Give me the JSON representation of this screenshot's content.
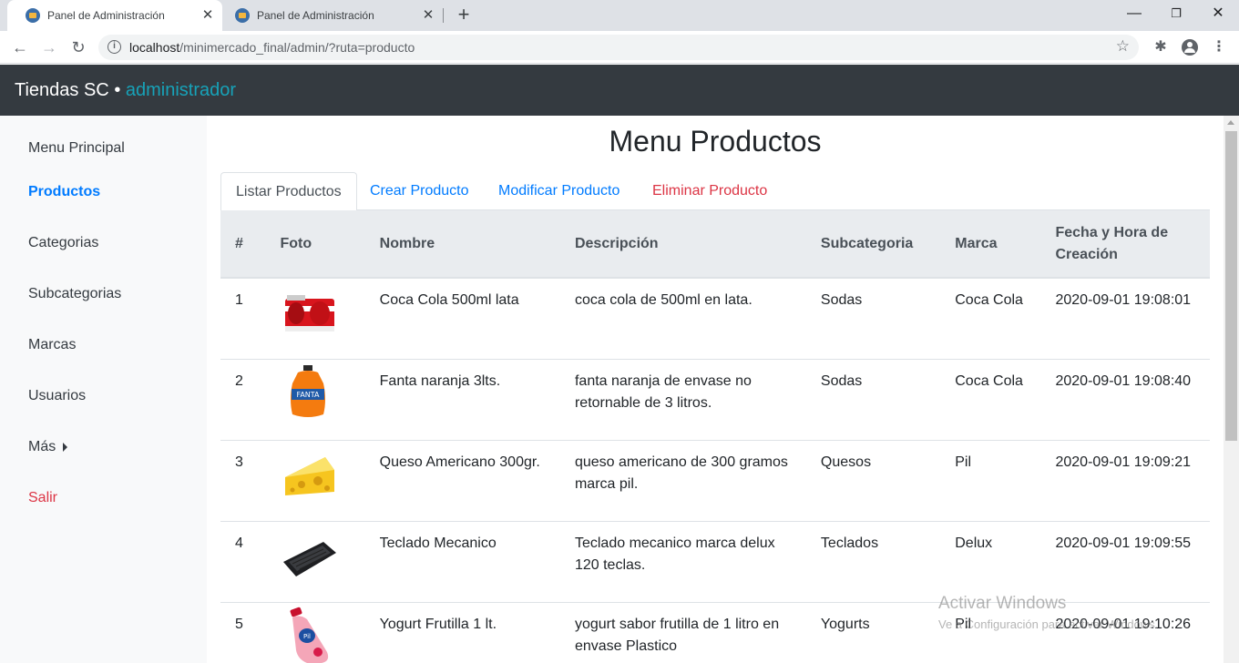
{
  "browser": {
    "tabs": [
      {
        "title": "Panel de Administración"
      },
      {
        "title": "Panel de Administración"
      }
    ],
    "url_host": "localhost",
    "url_path": "/minimercado_final/admin/?ruta=producto"
  },
  "app": {
    "brand": "Tiendas SC",
    "separator": "•",
    "role": "administrador"
  },
  "sidebar": {
    "items": [
      {
        "label": "Menu Principal"
      },
      {
        "label": "Productos"
      },
      {
        "label": "Categorias"
      },
      {
        "label": "Subcategorias"
      },
      {
        "label": "Marcas"
      },
      {
        "label": "Usuarios"
      },
      {
        "label": "Más"
      },
      {
        "label": "Salir"
      }
    ]
  },
  "main": {
    "title": "Menu Productos",
    "tabs": [
      {
        "label": "Listar Productos"
      },
      {
        "label": "Crear Producto"
      },
      {
        "label": "Modificar Producto"
      },
      {
        "label": "Eliminar Producto"
      }
    ]
  },
  "table": {
    "headers": [
      "#",
      "Foto",
      "Nombre",
      "Descripción",
      "Subcategoria",
      "Marca",
      "Fecha y Hora de Creación"
    ],
    "rows": [
      {
        "num": "1",
        "photo": "coca-cola-can-pack",
        "nombre": "Coca Cola 500ml lata",
        "descripcion": "coca cola de 500ml en lata.",
        "subcategoria": "Sodas",
        "marca": "Coca Cola",
        "fecha": "2020-09-01 19:08:01"
      },
      {
        "num": "2",
        "photo": "fanta-bottle",
        "nombre": "Fanta naranja 3lts.",
        "descripcion": "fanta naranja de envase no retornable de 3 litros.",
        "subcategoria": "Sodas",
        "marca": "Coca Cola",
        "fecha": "2020-09-01 19:08:40"
      },
      {
        "num": "3",
        "photo": "cheese-wedge",
        "nombre": "Queso Americano 300gr.",
        "descripcion": "queso americano de 300 gramos marca pil.",
        "subcategoria": "Quesos",
        "marca": "Pil",
        "fecha": "2020-09-01 19:09:21"
      },
      {
        "num": "4",
        "photo": "keyboard",
        "nombre": "Teclado Mecanico",
        "descripcion": "Teclado mecanico marca delux 120 teclas.",
        "subcategoria": "Teclados",
        "marca": "Delux",
        "fecha": "2020-09-01 19:09:55"
      },
      {
        "num": "5",
        "photo": "yogurt-bottle",
        "nombre": "Yogurt Frutilla 1 lt.",
        "descripcion": "yogurt sabor frutilla de 1 litro en envase Plastico",
        "subcategoria": "Yogurts",
        "marca": "Pil",
        "fecha": "2020-09-01 19:10:26"
      }
    ]
  },
  "watermark": {
    "line1": "Activar Windows",
    "line2": "Ve a Configuración para activar Windows."
  },
  "colors": {
    "navbar": "#343a40",
    "accent": "#17a2b8",
    "link": "#007bff",
    "danger": "#dc3545"
  }
}
